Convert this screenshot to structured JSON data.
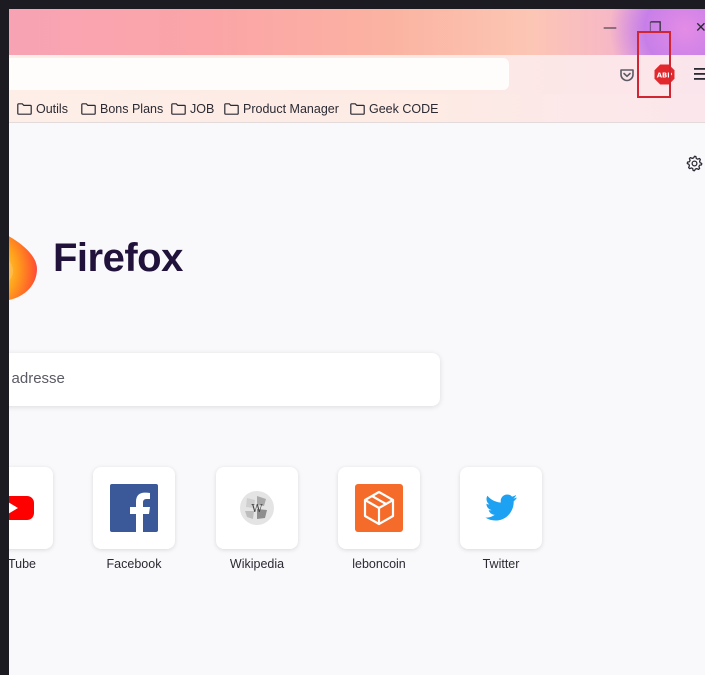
{
  "window": {
    "controls": {
      "minimize": "—",
      "restore": "❐",
      "close": "✕"
    }
  },
  "toolbar": {
    "pocket_icon": "pocket-icon",
    "extension_icon": "adblock-plus-icon",
    "extension_label": "ABP",
    "menu_icon": "hamburger-menu-icon",
    "highlight_color": "#d12531"
  },
  "bookmarks": [
    {
      "label": "Outils"
    },
    {
      "label": "Bons Plans"
    },
    {
      "label": "JOB"
    },
    {
      "label": "Product Manager"
    },
    {
      "label": "Geek CODE"
    }
  ],
  "newtab": {
    "brand": "Firefox",
    "search_placeholder": "e adresse",
    "shortcuts": [
      {
        "label": "Tube",
        "icon": "youtube-icon"
      },
      {
        "label": "Facebook",
        "icon": "facebook-icon"
      },
      {
        "label": "Wikipedia",
        "icon": "wikipedia-icon"
      },
      {
        "label": "leboncoin",
        "icon": "leboncoin-icon"
      },
      {
        "label": "Twitter",
        "icon": "twitter-icon"
      }
    ]
  }
}
